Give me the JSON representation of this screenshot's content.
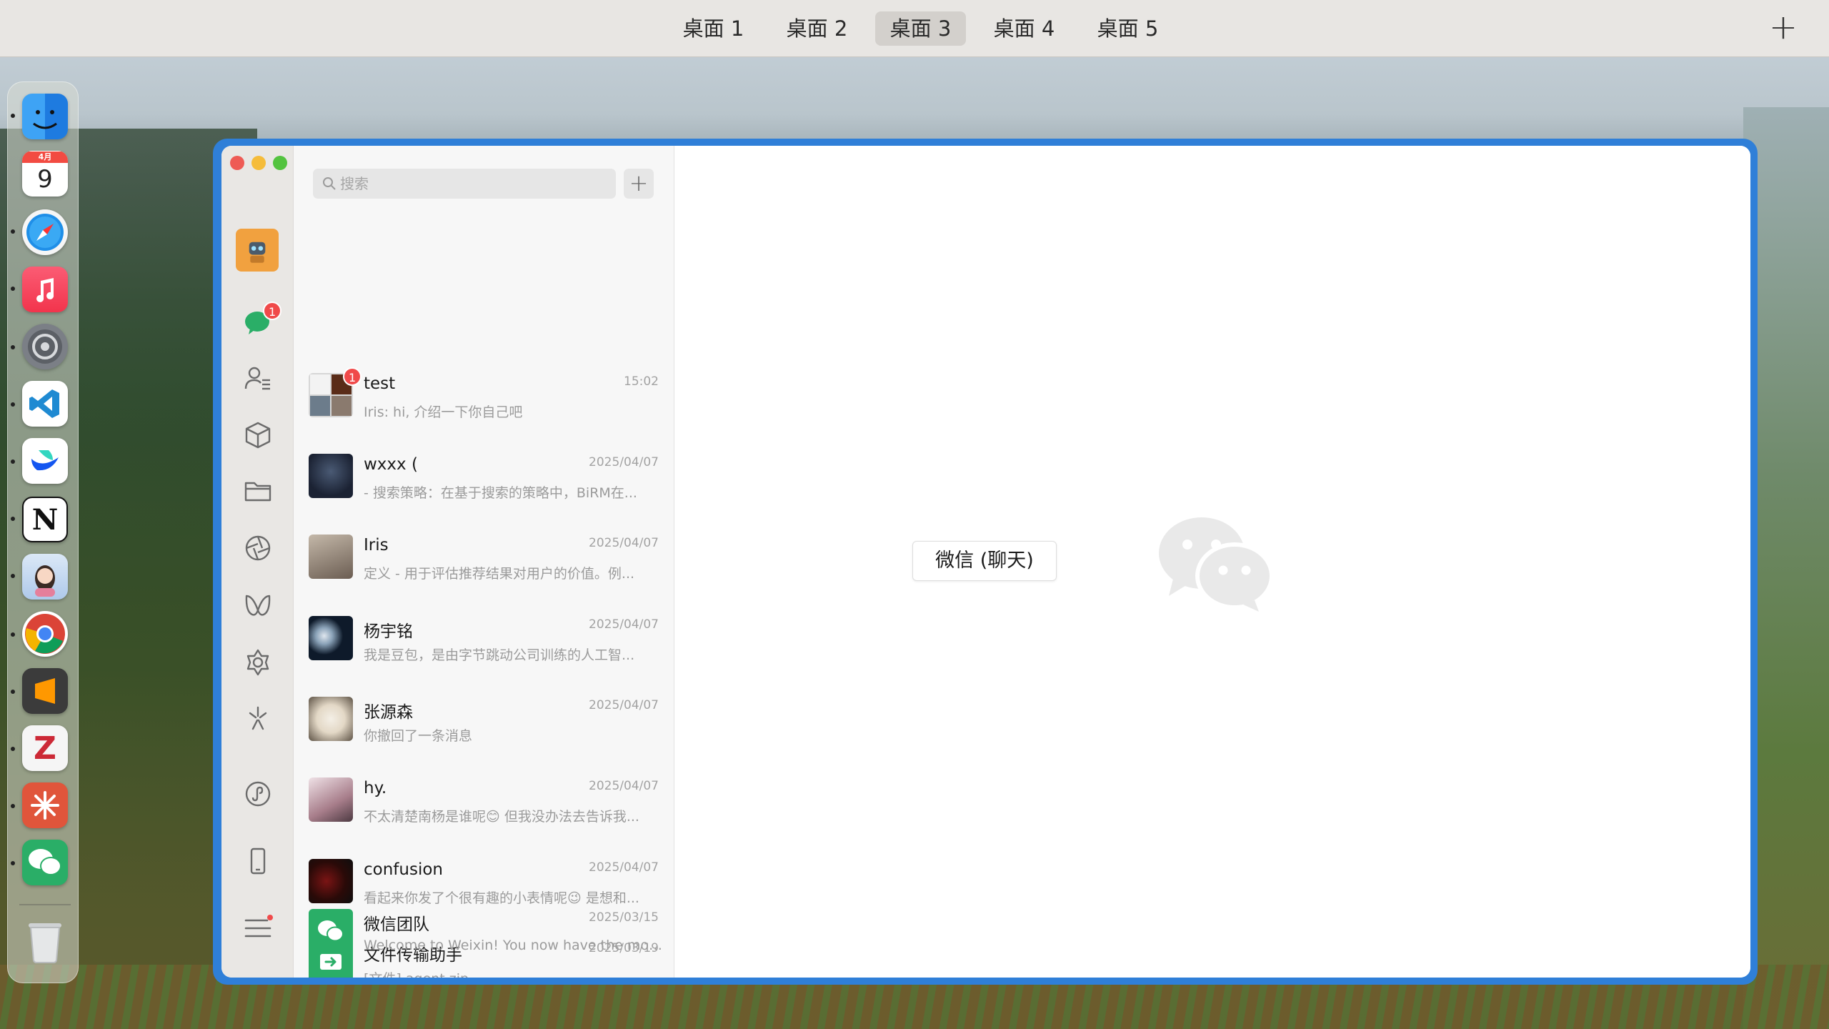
{
  "desktop_bar": {
    "tabs": [
      "桌面 1",
      "桌面 2",
      "桌面 3",
      "桌面 4",
      "桌面 5"
    ],
    "active_tab": "桌面 3",
    "add_label": "+"
  },
  "dock": {
    "calendar_month": "4月",
    "calendar_day": "9",
    "items": [
      "finder",
      "calendar",
      "safari",
      "music",
      "system-settings",
      "vscode",
      "lark",
      "notion",
      "avatar-app",
      "chrome",
      "sublime-text",
      "zotero",
      "perplexity",
      "wechat",
      "trash"
    ]
  },
  "wechat": {
    "search_placeholder": "搜索",
    "add_label": "+",
    "sidebar_badges": {
      "chats": "1"
    },
    "chats": [
      {
        "name": "test",
        "time": "15:02",
        "msg": "Iris: hi, 介绍一下你自己吧",
        "badge": "1"
      },
      {
        "name": "wxxx (",
        "time": "2025/04/07",
        "msg": "- 搜索策略：在基于搜索的策略中，BiRM在..."
      },
      {
        "name": "Iris",
        "time": "2025/04/07",
        "msg": "定义   - 用于评估推荐结果对用户的价值。例..."
      },
      {
        "name": "杨宇铭",
        "time": "2025/04/07",
        "msg": "我是豆包，是由字节跳动公司训练的人工智..."
      },
      {
        "name": "张源森",
        "time": "2025/04/07",
        "msg": "你撤回了一条消息"
      },
      {
        "name": "hy.",
        "time": "2025/04/07",
        "msg": "不太清楚南杨是谁呢😊 但我没办法去告诉我..."
      },
      {
        "name": "confusion",
        "time": "2025/04/07",
        "msg": "看起来你发了个很有趣的小表情呢😉 是想和..."
      },
      {
        "name": "文件传输助手",
        "time": "2025/03/19",
        "msg": "[文件] agent.zip"
      },
      {
        "name": "微信团队",
        "time": "2025/03/15",
        "msg": "Welcome to Weixin! You now have the mos..."
      }
    ],
    "main_button": "微信 (聊天)"
  },
  "colors": {
    "wechat_green": "#2aae67",
    "badge_red": "#f04a4a",
    "window_highlight": "#2f7fd8"
  }
}
